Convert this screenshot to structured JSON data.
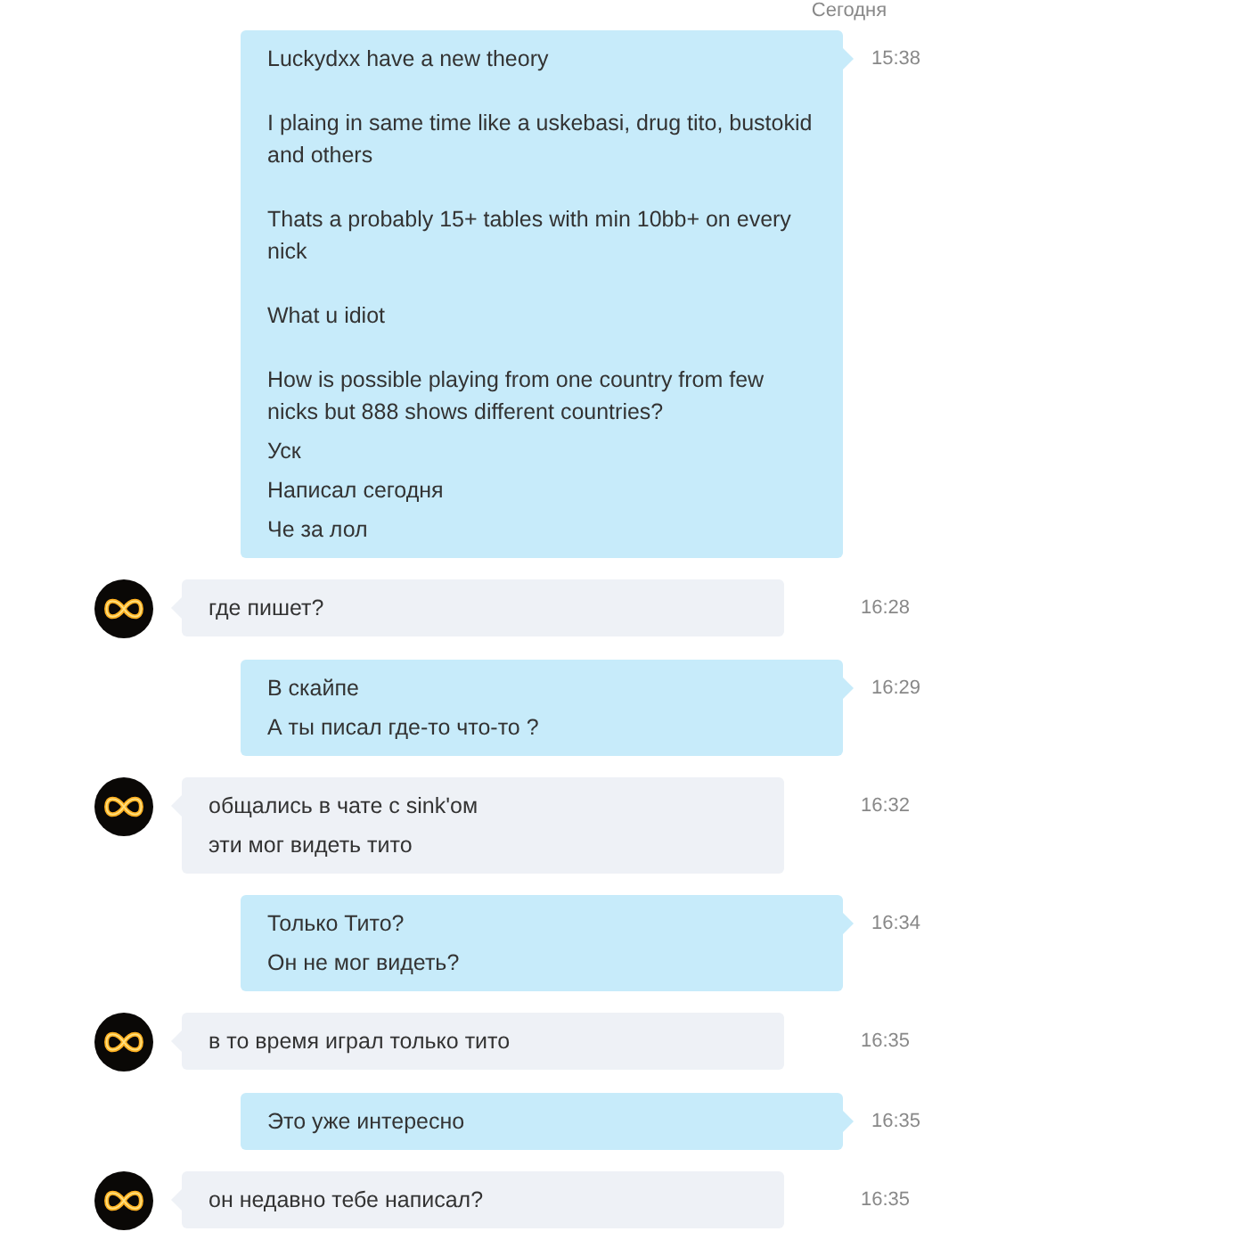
{
  "date_header": "Сегодня",
  "messages": [
    {
      "kind": "outgoing",
      "time": "15:38",
      "lines": [
        "Luckydxx have a new theory\n\nI plaing in same time like a uskebasi, drug tito, bustokid and others\n\nThats a probably 15+ tables with min 10bb+ on every nick\n\nWhat u idiot\n\nHow is possible playing from one country from few nicks but 888 shows different countries?",
        "Уск",
        "Написал сегодня",
        "Че за лол"
      ]
    },
    {
      "kind": "incoming",
      "time": "16:28",
      "lines": [
        "где пишет?"
      ]
    },
    {
      "kind": "outgoing",
      "time": "16:29",
      "lines": [
        "В скайпе",
        "А ты писал где-то что-то ?"
      ]
    },
    {
      "kind": "incoming",
      "time": "16:32",
      "lines": [
        "общались в чате с sink'ом",
        "эти мог видеть тито"
      ]
    },
    {
      "kind": "outgoing",
      "time": "16:34",
      "lines": [
        "Только Тито?",
        "Он не мог видеть?"
      ]
    },
    {
      "kind": "incoming",
      "time": "16:35",
      "lines": [
        "в то время играл только тито"
      ]
    },
    {
      "kind": "outgoing",
      "time": "16:35",
      "lines": [
        "Это уже интересно"
      ]
    },
    {
      "kind": "incoming",
      "time": "16:35",
      "lines": [
        "он недавно тебе написал?"
      ]
    }
  ]
}
